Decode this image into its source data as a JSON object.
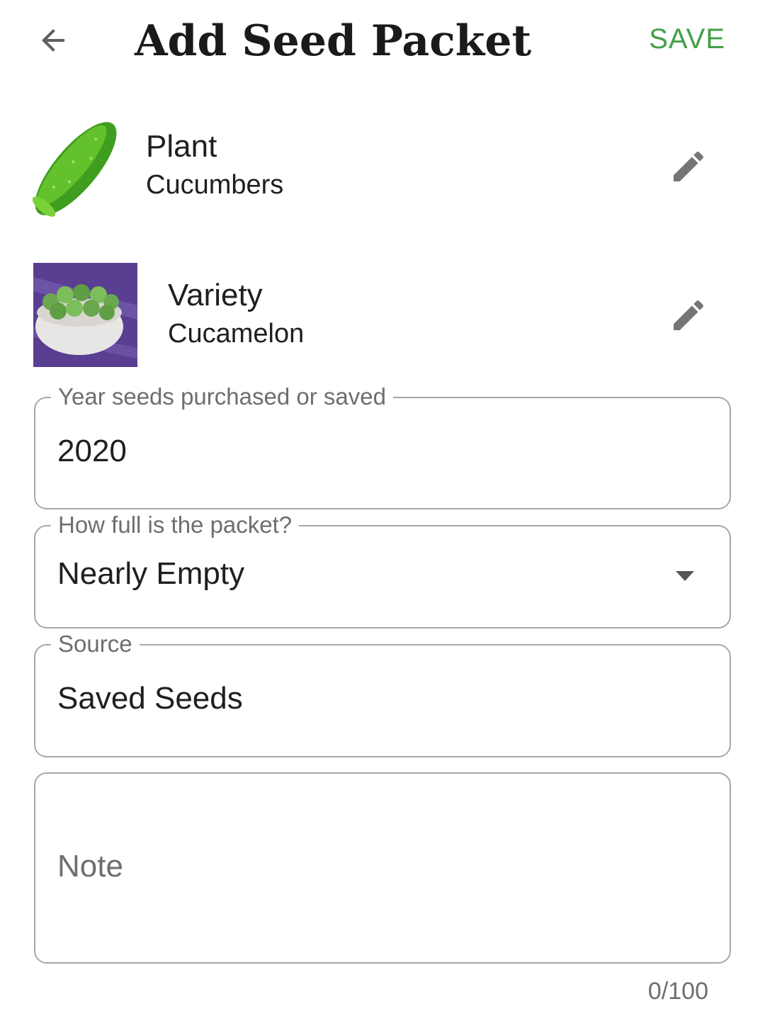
{
  "header": {
    "title": "Add Seed Packet",
    "save_label": "SAVE",
    "back_icon": "arrow-back-icon",
    "accent_color": "#43a047"
  },
  "plant": {
    "label": "Plant",
    "value": "Cucumbers",
    "image": "cucumber-illustration",
    "edit_icon": "pencil-icon"
  },
  "variety": {
    "label": "Variety",
    "value": "Cucamelon",
    "image": "cucamelon-bowl-photo",
    "edit_icon": "pencil-icon"
  },
  "fields": {
    "year": {
      "label": "Year seeds purchased or saved",
      "value": "2020"
    },
    "fullness": {
      "label": "How full is the packet?",
      "value": "Nearly Empty"
    },
    "source": {
      "label": "Source",
      "value": "Saved Seeds"
    },
    "note": {
      "placeholder": "Note",
      "value": "",
      "counter": "0/100"
    }
  }
}
